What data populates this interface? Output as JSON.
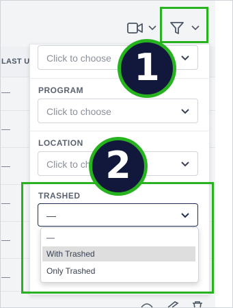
{
  "table": {
    "column_header": "LAST U",
    "row_values": [
      "—",
      "—",
      "—",
      "—",
      "—",
      "—",
      "—"
    ]
  },
  "toolbar": {
    "video_icon": "video-camera-icon",
    "filter_icon": "funnel-icon",
    "chevron_icon": "chevron-down-icon"
  },
  "filters": {
    "first": {
      "placeholder": "Click to choose"
    },
    "program": {
      "label": "PROGRAM",
      "placeholder": "Click to choose"
    },
    "location": {
      "label": "LOCATION",
      "placeholder": "Click to choose"
    },
    "trashed": {
      "label": "TRASHED",
      "value": "—",
      "options": [
        "—",
        "With Trashed",
        "Only Trashed"
      ],
      "hovered_option": "With Trashed"
    }
  },
  "callouts": {
    "one": "1",
    "two": "2"
  },
  "colors": {
    "highlight": "#27b21f",
    "badge": "#12183b",
    "active_border": "#1c2d4f"
  }
}
